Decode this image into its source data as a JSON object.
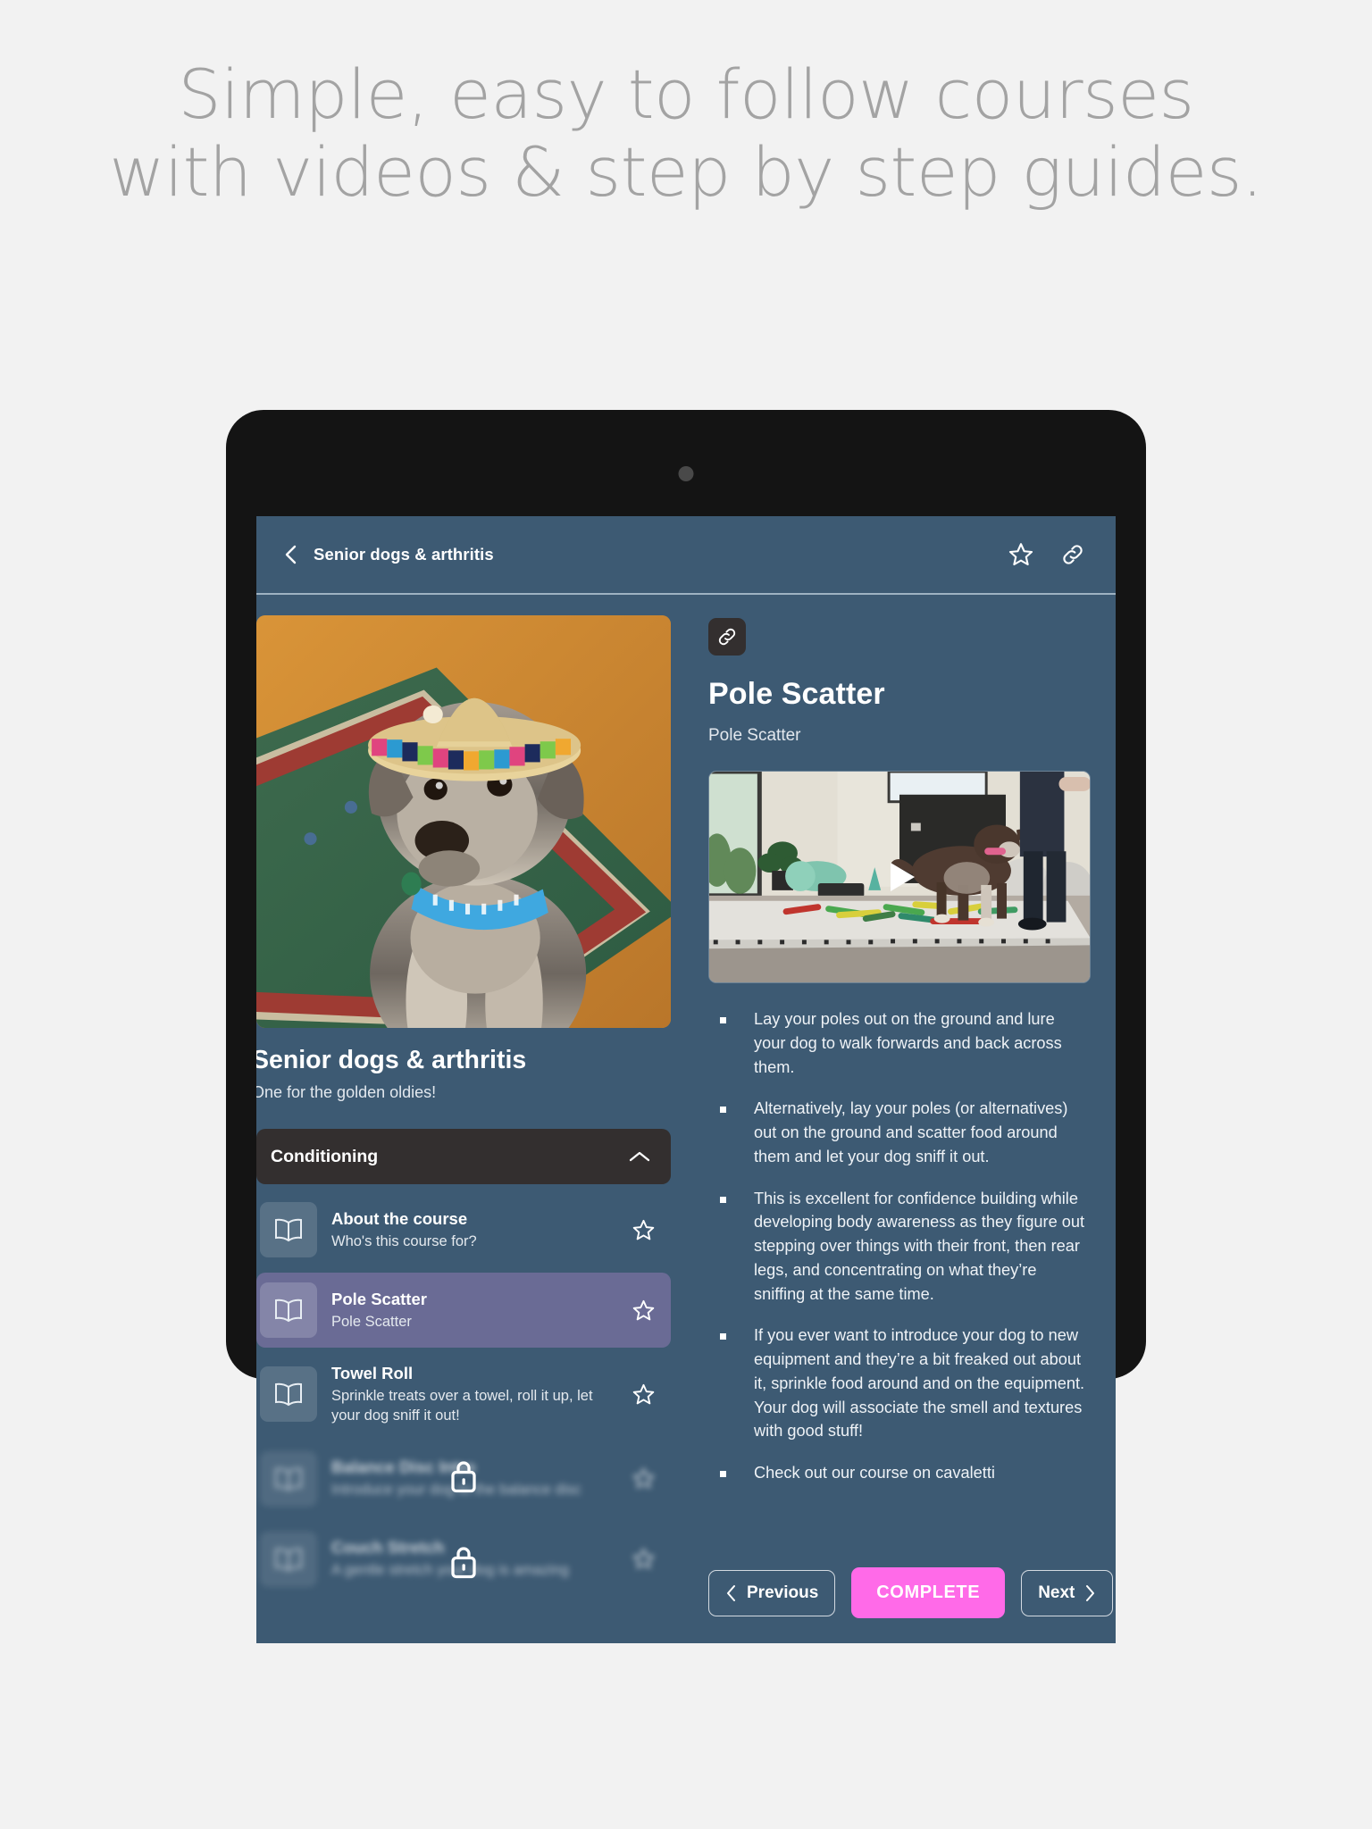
{
  "headline": "Simple, easy to follow courses with videos & step by step guides.",
  "colors": {
    "page_background": "#f2f2f2",
    "headline_text": "#a3a3a3",
    "device_bezel": "#141414",
    "app_background": "#3d5a73",
    "section_header": "#332f2f",
    "selected_row": "#6a6b95",
    "complete_button": "#ff6ae8",
    "text_primary": "#ffffff"
  },
  "appbar": {
    "back_icon": "chevron-left-icon",
    "title": "Senior dogs & arthritis",
    "actions": [
      {
        "icon": "star-outline-icon",
        "name": "favourite"
      },
      {
        "icon": "link-icon",
        "name": "share-link"
      }
    ]
  },
  "left_pane": {
    "hero_image_alt": "Terrier dog wearing a straw sombrero sitting on a patterned rug",
    "course_title": "Senior dogs & arthritis",
    "course_subtitle": "One for the golden oldies!",
    "section": {
      "label": "Conditioning",
      "chevron_icon": "chevron-up-icon",
      "expanded": true
    },
    "lessons": [
      {
        "title": "About the course",
        "desc": "Who's this course for?",
        "icon": "book-icon",
        "star_icon": "star-outline-icon",
        "selected": false,
        "locked": false
      },
      {
        "title": "Pole Scatter",
        "desc": "Pole Scatter",
        "icon": "book-icon",
        "star_icon": "star-outline-icon",
        "selected": true,
        "locked": false
      },
      {
        "title": "Towel Roll",
        "desc": "Sprinkle treats over a towel, roll it up, let your dog sniff it out!",
        "icon": "book-icon",
        "star_icon": "star-outline-icon",
        "selected": false,
        "locked": false
      },
      {
        "title": "Balance Disc Intro",
        "desc": "Introduce your dog to the balance disc",
        "icon": "book-icon",
        "star_icon": "star-outline-icon",
        "selected": false,
        "locked": true,
        "lock_icon": "lock-icon"
      },
      {
        "title": "Couch Stretch",
        "desc": "A gentle stretch your dog is amazing",
        "icon": "book-icon",
        "star_icon": "star-outline-icon",
        "selected": false,
        "locked": true,
        "lock_icon": "lock-icon"
      }
    ]
  },
  "right_pane": {
    "link_chip_icon": "link-icon",
    "lesson_title": "Pole Scatter",
    "lesson_subtitle": "Pole Scatter",
    "video": {
      "alt": "Dog walking over colourful cavaletti poles laid on a rug in a home gym",
      "play_icon": "play-icon"
    },
    "bullets": [
      "Lay your poles out on the ground and lure your dog to walk forwards and back across them.",
      "Alternatively, lay your poles (or alternatives) out on the ground and scatter food around them and let your dog sniff it out.",
      "This is excellent for confidence building while developing body awareness as they figure out stepping over things with their front, then rear legs, and concentrating on what they’re sniffing at the same time.",
      "If you ever want to introduce your dog to new equipment and they’re a bit freaked out about it, sprinkle food around and on the equipment. Your dog will associate the smell and textures with good stuff!",
      "Check out our course on cavaletti"
    ],
    "footer": {
      "previous_label": "Previous",
      "previous_icon": "chevron-left-icon",
      "complete_label": "COMPLETE",
      "next_label": "Next",
      "next_icon": "chevron-right-icon"
    }
  }
}
